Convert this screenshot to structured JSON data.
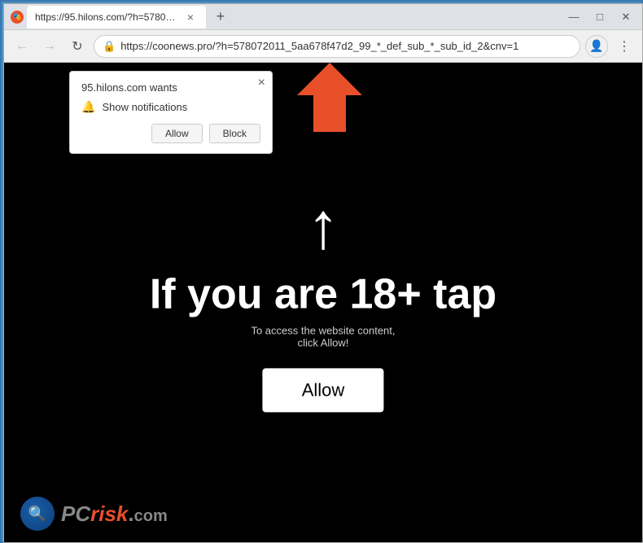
{
  "browser": {
    "tab": {
      "title": "https://95.hilons.com/?h=57807...",
      "favicon": "🔒"
    },
    "address_bar": {
      "url": "https://coonews.pro/?h=578072011_5aa678f47d2_99_*_def_sub_*_sub_id_2&cnv=1"
    },
    "controls": {
      "minimize": "—",
      "maximize": "□",
      "close": "✕"
    },
    "nav": {
      "back": "←",
      "forward": "→",
      "refresh": "↻"
    }
  },
  "popup": {
    "title": "95.hilons.com wants",
    "notification_label": "Show notifications",
    "allow_btn": "Allow",
    "block_btn": "Block",
    "close": "×"
  },
  "page": {
    "age_text": "If you are 18+ tap",
    "small_text_line1": "To access the website content,",
    "small_text_line2": "click Allow!",
    "allow_button": "Allow"
  },
  "logo": {
    "pc": "PC",
    "risk": "risk",
    "dot": ".",
    "com": "com"
  }
}
